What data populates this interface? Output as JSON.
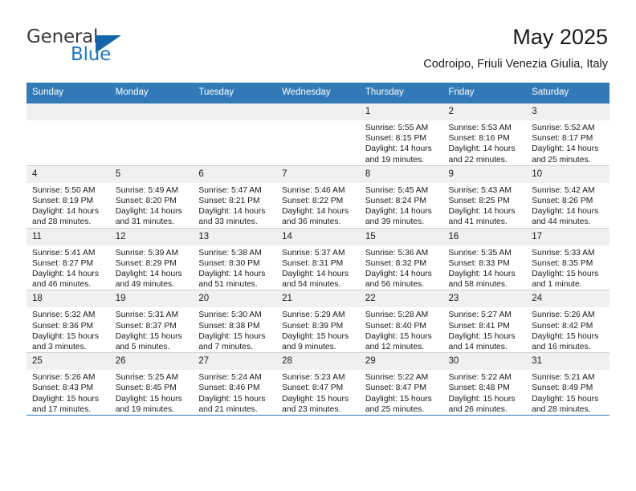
{
  "logo": {
    "word_one": "General",
    "word_two": "Blue",
    "icon": "triangle-logo-mark"
  },
  "header": {
    "title": "May 2025",
    "subtitle": "Codroipo, Friuli Venezia Giulia, Italy"
  },
  "colors": {
    "header_blue": "#3279b7",
    "logo_blue": "#1f77c4",
    "daynum_bg": "#f0f0f0",
    "grid_line": "#d0d0d0"
  },
  "calendar": {
    "weekday_headers": [
      "Sunday",
      "Monday",
      "Tuesday",
      "Wednesday",
      "Thursday",
      "Friday",
      "Saturday"
    ],
    "labels": {
      "sunrise": "Sunrise:",
      "sunset": "Sunset:",
      "daylight": "Daylight:"
    },
    "weeks": [
      [
        {
          "day": ""
        },
        {
          "day": ""
        },
        {
          "day": ""
        },
        {
          "day": ""
        },
        {
          "day": "1",
          "sunrise": "Sunrise: 5:55 AM",
          "sunset": "Sunset: 8:15 PM",
          "daylight_1": "Daylight: 14 hours",
          "daylight_2": "and 19 minutes."
        },
        {
          "day": "2",
          "sunrise": "Sunrise: 5:53 AM",
          "sunset": "Sunset: 8:16 PM",
          "daylight_1": "Daylight: 14 hours",
          "daylight_2": "and 22 minutes."
        },
        {
          "day": "3",
          "sunrise": "Sunrise: 5:52 AM",
          "sunset": "Sunset: 8:17 PM",
          "daylight_1": "Daylight: 14 hours",
          "daylight_2": "and 25 minutes."
        }
      ],
      [
        {
          "day": "4",
          "sunrise": "Sunrise: 5:50 AM",
          "sunset": "Sunset: 8:19 PM",
          "daylight_1": "Daylight: 14 hours",
          "daylight_2": "and 28 minutes."
        },
        {
          "day": "5",
          "sunrise": "Sunrise: 5:49 AM",
          "sunset": "Sunset: 8:20 PM",
          "daylight_1": "Daylight: 14 hours",
          "daylight_2": "and 31 minutes."
        },
        {
          "day": "6",
          "sunrise": "Sunrise: 5:47 AM",
          "sunset": "Sunset: 8:21 PM",
          "daylight_1": "Daylight: 14 hours",
          "daylight_2": "and 33 minutes."
        },
        {
          "day": "7",
          "sunrise": "Sunrise: 5:46 AM",
          "sunset": "Sunset: 8:22 PM",
          "daylight_1": "Daylight: 14 hours",
          "daylight_2": "and 36 minutes."
        },
        {
          "day": "8",
          "sunrise": "Sunrise: 5:45 AM",
          "sunset": "Sunset: 8:24 PM",
          "daylight_1": "Daylight: 14 hours",
          "daylight_2": "and 39 minutes."
        },
        {
          "day": "9",
          "sunrise": "Sunrise: 5:43 AM",
          "sunset": "Sunset: 8:25 PM",
          "daylight_1": "Daylight: 14 hours",
          "daylight_2": "and 41 minutes."
        },
        {
          "day": "10",
          "sunrise": "Sunrise: 5:42 AM",
          "sunset": "Sunset: 8:26 PM",
          "daylight_1": "Daylight: 14 hours",
          "daylight_2": "and 44 minutes."
        }
      ],
      [
        {
          "day": "11",
          "sunrise": "Sunrise: 5:41 AM",
          "sunset": "Sunset: 8:27 PM",
          "daylight_1": "Daylight: 14 hours",
          "daylight_2": "and 46 minutes."
        },
        {
          "day": "12",
          "sunrise": "Sunrise: 5:39 AM",
          "sunset": "Sunset: 8:29 PM",
          "daylight_1": "Daylight: 14 hours",
          "daylight_2": "and 49 minutes."
        },
        {
          "day": "13",
          "sunrise": "Sunrise: 5:38 AM",
          "sunset": "Sunset: 8:30 PM",
          "daylight_1": "Daylight: 14 hours",
          "daylight_2": "and 51 minutes."
        },
        {
          "day": "14",
          "sunrise": "Sunrise: 5:37 AM",
          "sunset": "Sunset: 8:31 PM",
          "daylight_1": "Daylight: 14 hours",
          "daylight_2": "and 54 minutes."
        },
        {
          "day": "15",
          "sunrise": "Sunrise: 5:36 AM",
          "sunset": "Sunset: 8:32 PM",
          "daylight_1": "Daylight: 14 hours",
          "daylight_2": "and 56 minutes."
        },
        {
          "day": "16",
          "sunrise": "Sunrise: 5:35 AM",
          "sunset": "Sunset: 8:33 PM",
          "daylight_1": "Daylight: 14 hours",
          "daylight_2": "and 58 minutes."
        },
        {
          "day": "17",
          "sunrise": "Sunrise: 5:33 AM",
          "sunset": "Sunset: 8:35 PM",
          "daylight_1": "Daylight: 15 hours",
          "daylight_2": "and 1 minute."
        }
      ],
      [
        {
          "day": "18",
          "sunrise": "Sunrise: 5:32 AM",
          "sunset": "Sunset: 8:36 PM",
          "daylight_1": "Daylight: 15 hours",
          "daylight_2": "and 3 minutes."
        },
        {
          "day": "19",
          "sunrise": "Sunrise: 5:31 AM",
          "sunset": "Sunset: 8:37 PM",
          "daylight_1": "Daylight: 15 hours",
          "daylight_2": "and 5 minutes."
        },
        {
          "day": "20",
          "sunrise": "Sunrise: 5:30 AM",
          "sunset": "Sunset: 8:38 PM",
          "daylight_1": "Daylight: 15 hours",
          "daylight_2": "and 7 minutes."
        },
        {
          "day": "21",
          "sunrise": "Sunrise: 5:29 AM",
          "sunset": "Sunset: 8:39 PM",
          "daylight_1": "Daylight: 15 hours",
          "daylight_2": "and 9 minutes."
        },
        {
          "day": "22",
          "sunrise": "Sunrise: 5:28 AM",
          "sunset": "Sunset: 8:40 PM",
          "daylight_1": "Daylight: 15 hours",
          "daylight_2": "and 12 minutes."
        },
        {
          "day": "23",
          "sunrise": "Sunrise: 5:27 AM",
          "sunset": "Sunset: 8:41 PM",
          "daylight_1": "Daylight: 15 hours",
          "daylight_2": "and 14 minutes."
        },
        {
          "day": "24",
          "sunrise": "Sunrise: 5:26 AM",
          "sunset": "Sunset: 8:42 PM",
          "daylight_1": "Daylight: 15 hours",
          "daylight_2": "and 16 minutes."
        }
      ],
      [
        {
          "day": "25",
          "sunrise": "Sunrise: 5:26 AM",
          "sunset": "Sunset: 8:43 PM",
          "daylight_1": "Daylight: 15 hours",
          "daylight_2": "and 17 minutes."
        },
        {
          "day": "26",
          "sunrise": "Sunrise: 5:25 AM",
          "sunset": "Sunset: 8:45 PM",
          "daylight_1": "Daylight: 15 hours",
          "daylight_2": "and 19 minutes."
        },
        {
          "day": "27",
          "sunrise": "Sunrise: 5:24 AM",
          "sunset": "Sunset: 8:46 PM",
          "daylight_1": "Daylight: 15 hours",
          "daylight_2": "and 21 minutes."
        },
        {
          "day": "28",
          "sunrise": "Sunrise: 5:23 AM",
          "sunset": "Sunset: 8:47 PM",
          "daylight_1": "Daylight: 15 hours",
          "daylight_2": "and 23 minutes."
        },
        {
          "day": "29",
          "sunrise": "Sunrise: 5:22 AM",
          "sunset": "Sunset: 8:47 PM",
          "daylight_1": "Daylight: 15 hours",
          "daylight_2": "and 25 minutes."
        },
        {
          "day": "30",
          "sunrise": "Sunrise: 5:22 AM",
          "sunset": "Sunset: 8:48 PM",
          "daylight_1": "Daylight: 15 hours",
          "daylight_2": "and 26 minutes."
        },
        {
          "day": "31",
          "sunrise": "Sunrise: 5:21 AM",
          "sunset": "Sunset: 8:49 PM",
          "daylight_1": "Daylight: 15 hours",
          "daylight_2": "and 28 minutes."
        }
      ]
    ]
  }
}
